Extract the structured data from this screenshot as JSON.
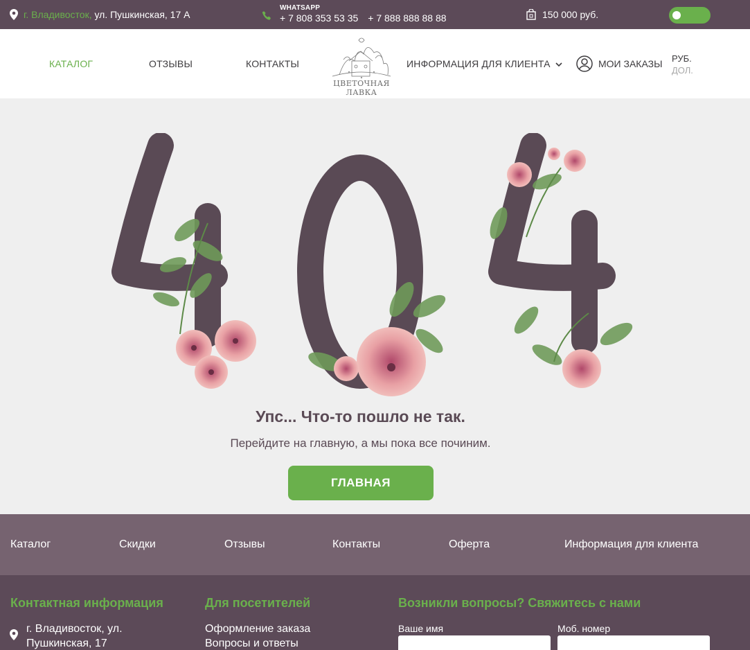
{
  "topbar": {
    "city": "г. Владивосток,",
    "street": " ул. Пушкинская, 17 А",
    "whatsapp_label": "WHATSAPP",
    "phone1": "+ 7 808 353 53 35",
    "phone2": "+ 7 888 888 88 88",
    "cart_sum": "150 000 руб."
  },
  "nav": {
    "catalog": "КАТАЛОГ",
    "reviews": "ОТЗЫВЫ",
    "contacts": "КОНТАКТЫ",
    "client_info": "ИНФОРМАЦИЯ ДЛЯ КЛИЕНТА",
    "orders": "МОИ ЗАКАЗЫ",
    "currency_rub": "РУБ.",
    "currency_usd": "ДОЛ."
  },
  "logo": {
    "text": "ЦВЕТОЧНАЯ ЛАВКА"
  },
  "error": {
    "code": "404",
    "heading": "Упс... Что-то пошло не так.",
    "subtext": "Перейдите на главную, а мы пока все починим.",
    "button": "ГЛАВНАЯ"
  },
  "footer_menu": [
    "Каталог",
    "Скидки",
    "Отзывы",
    "Контакты",
    "Оферта",
    "Информация для клиента"
  ],
  "footer": {
    "contact_title": "Контактная информация",
    "address_line1": "г. Владивосток, ул.",
    "address_line2": "Пушкинская, 17",
    "visitors_title": "Для посетителей",
    "visitor_link1": "Оформление заказа",
    "visitor_link2": "Вопросы и ответы",
    "questions_title": "Возникли вопросы? Свяжитесь с нами",
    "name_label": "Ваше имя",
    "phone_label": "Моб. номер"
  },
  "colors": {
    "accent_green": "#6ab04c",
    "dark_plum": "#5c4a58",
    "menu_plum": "#766370",
    "digit_color": "#5a4a55"
  }
}
